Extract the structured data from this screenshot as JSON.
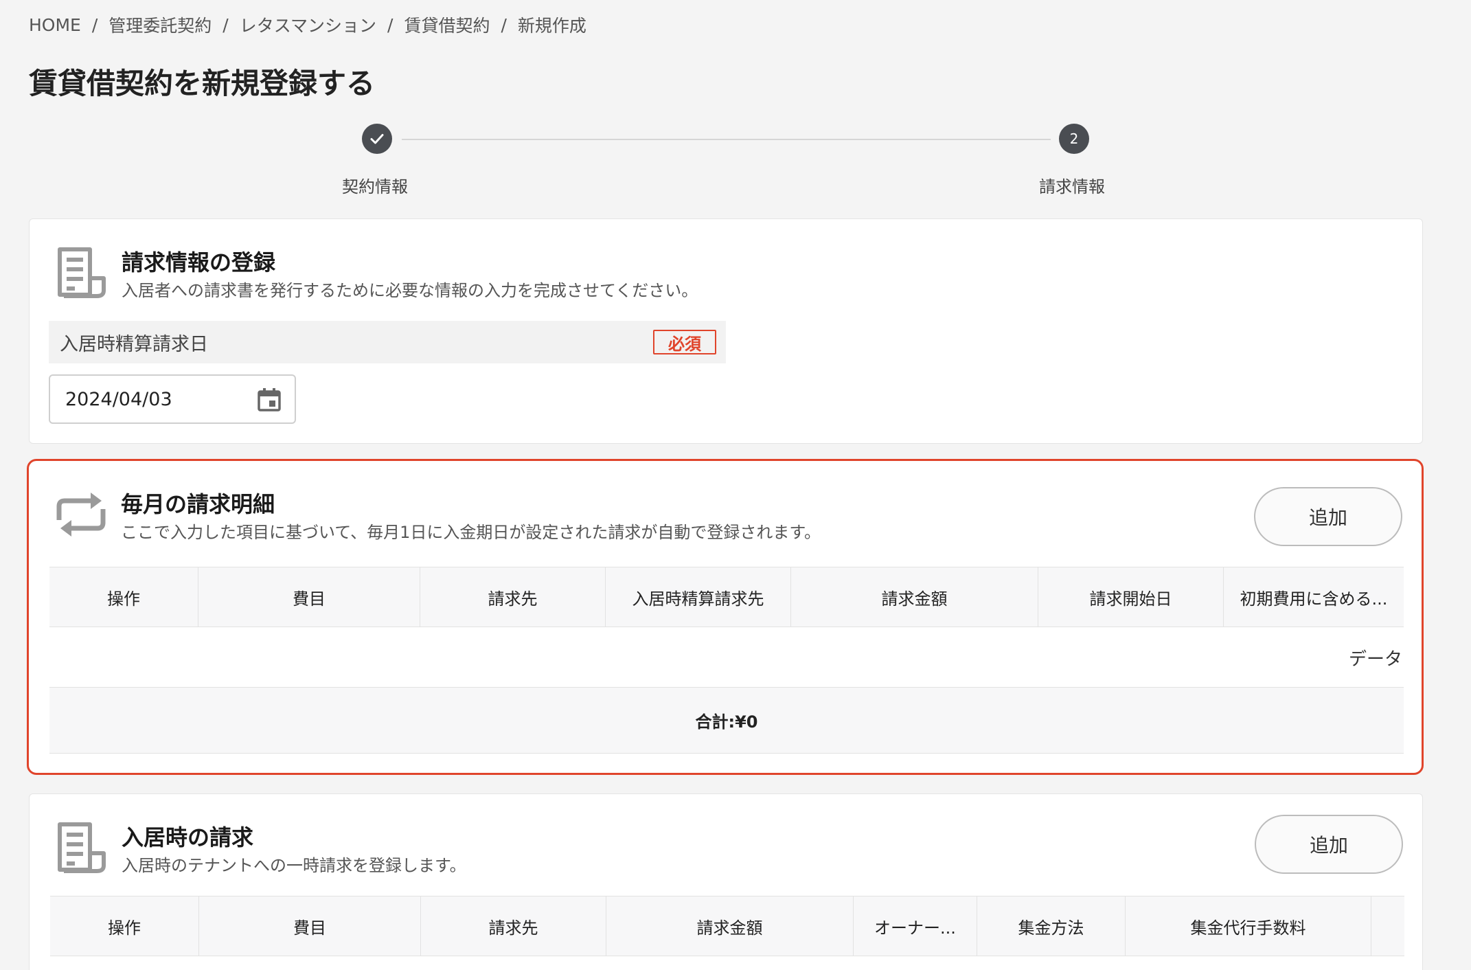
{
  "breadcrumb": {
    "items": [
      "HOME",
      "管理委託契約",
      "レタスマンション",
      "賃貸借契約",
      "新規作成"
    ],
    "separator": "/"
  },
  "page": {
    "title": "賃貸借契約を新規登録する"
  },
  "stepper": {
    "steps": [
      {
        "label": "契約情報",
        "status": "done",
        "badge": ""
      },
      {
        "label": "請求情報",
        "status": "current",
        "badge": "2"
      }
    ]
  },
  "billing_info": {
    "title": "請求情報の登録",
    "description": "入居者への請求書を発行するために必要な情報の入力を完成させてください。",
    "field_label": "入居時精算請求日",
    "required_label": "必須",
    "date_value": "2024/04/03"
  },
  "monthly": {
    "title": "毎月の請求明細",
    "description": "ここで入力した項目に基づいて、毎月1日に入金期日が設定された請求が自動で登録されます。",
    "add_label": "追加",
    "columns": [
      "操作",
      "費目",
      "請求先",
      "入居時精算請求先",
      "請求金額",
      "請求開始日",
      "初期費用に含める..."
    ],
    "empty_text": "データ",
    "total_label": "合計:¥0"
  },
  "move_in": {
    "title": "入居時の請求",
    "description": "入居時のテナントへの一時請求を登録します。",
    "add_label": "追加",
    "columns": [
      "操作",
      "費目",
      "請求先",
      "請求金額",
      "オーナー...",
      "集金方法",
      "集金代行手数料",
      ""
    ]
  },
  "colors": {
    "accent": "#e0442b",
    "step": "#4a4d52",
    "background": "#f4f4f4"
  }
}
